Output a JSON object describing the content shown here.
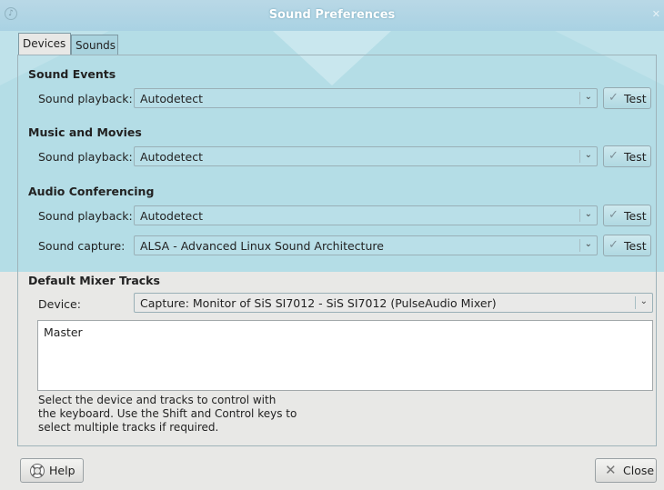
{
  "window": {
    "title": "Sound Preferences",
    "close_glyph": "✕"
  },
  "tabs": [
    {
      "label": "Devices",
      "active": true
    },
    {
      "label": "Sounds",
      "active": false
    }
  ],
  "sections": [
    {
      "title": "Sound Events",
      "rows": [
        {
          "label": "Sound playback:",
          "value": "Autodetect",
          "test": "Test"
        }
      ]
    },
    {
      "title": "Music and Movies",
      "rows": [
        {
          "label": "Sound playback:",
          "value": "Autodetect",
          "test": "Test"
        }
      ]
    },
    {
      "title": "Audio Conferencing",
      "rows": [
        {
          "label": "Sound playback:",
          "value": "Autodetect",
          "test": "Test"
        },
        {
          "label": "Sound capture:",
          "value": "ALSA - Advanced Linux Sound Architecture",
          "test": "Test"
        }
      ]
    },
    {
      "title": "Default Mixer Tracks"
    }
  ],
  "mixer": {
    "device_label": "Device:",
    "device_value": "Capture: Monitor of SiS SI7012 - SiS SI7012 (PulseAudio Mixer)",
    "tracks": [
      "Master"
    ],
    "help_text": [
      "Select the device and tracks to control with",
      "the keyboard. Use the Shift and Control keys to",
      "select multiple tracks if required."
    ]
  },
  "buttons": {
    "help": "Help",
    "close": "Close"
  },
  "icons": {
    "combo_arrow": "chevron-down-icon",
    "test": "checkmark-icon",
    "help": "lifebuoy-icon",
    "close": "close-icon"
  },
  "colors": {
    "titlebar": "#b9d8e6",
    "teal_background": "#b4dde6",
    "dialog": "#e8e8e6"
  }
}
